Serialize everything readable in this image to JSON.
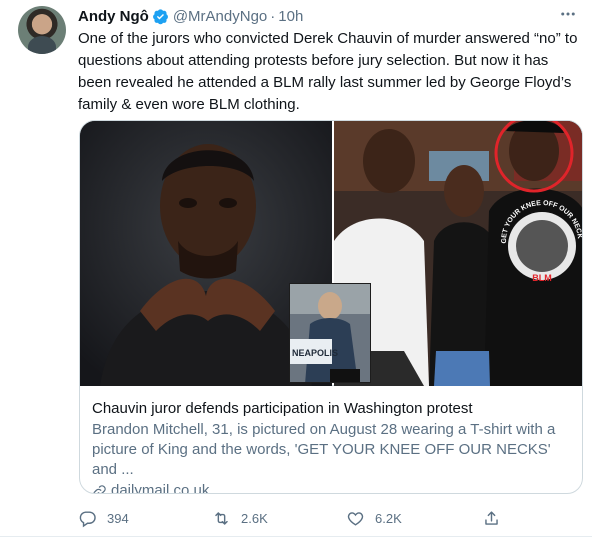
{
  "author": {
    "display_name": "Andy Ngô",
    "handle": "@MrAndyNgo",
    "separator": "·",
    "time": "10h"
  },
  "tweet": {
    "text": "One of the jurors who convicted Derek Chauvin of murder answered “no” to questions about attending protests before jury selection. But now it has been revealed he attended a BLM rally last summer led by George Floyd’s family & even wore BLM clothing."
  },
  "card": {
    "title": "Chauvin juror defends participation in Washington protest",
    "description": "Brandon Mitchell, 31, is pictured on August 28 wearing a T-shirt with a picture of King and the words, 'GET YOUR KNEE OFF OUR NECKS' and ...",
    "domain": "dailymail.co.uk",
    "image_text": {
      "shirt": "GET YOUR KNEE OFF OUR NECKS",
      "shirt_badge": "BLM",
      "inset_label": "NEAPOLIS"
    }
  },
  "actions": {
    "replies": "394",
    "retweets": "2.6K",
    "likes": "6.2K"
  },
  "colors": {
    "text_primary": "#0f1419",
    "text_secondary": "#5b7083",
    "verified": "#1da1f2",
    "border": "#cfd9de",
    "highlight_circle": "#e0242a"
  },
  "icons": [
    "verified-badge-icon",
    "more-icon",
    "link-icon",
    "reply-icon",
    "retweet-icon",
    "like-icon",
    "share-icon"
  ]
}
